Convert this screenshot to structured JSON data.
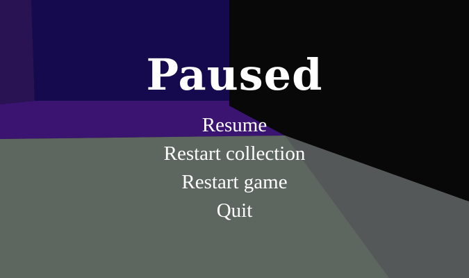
{
  "pause_menu": {
    "title": "Paused",
    "items": [
      {
        "label": "Resume"
      },
      {
        "label": "Restart collection"
      },
      {
        "label": "Restart game"
      },
      {
        "label": "Quit"
      }
    ]
  },
  "colors": {
    "back_wall": "#160a4e",
    "left_wall": "#27124f",
    "floor_edge": "#3b1472",
    "floor": "#5e6660",
    "floor_right": "#545454",
    "right_wall": "#080808",
    "text": "#ffffff"
  }
}
